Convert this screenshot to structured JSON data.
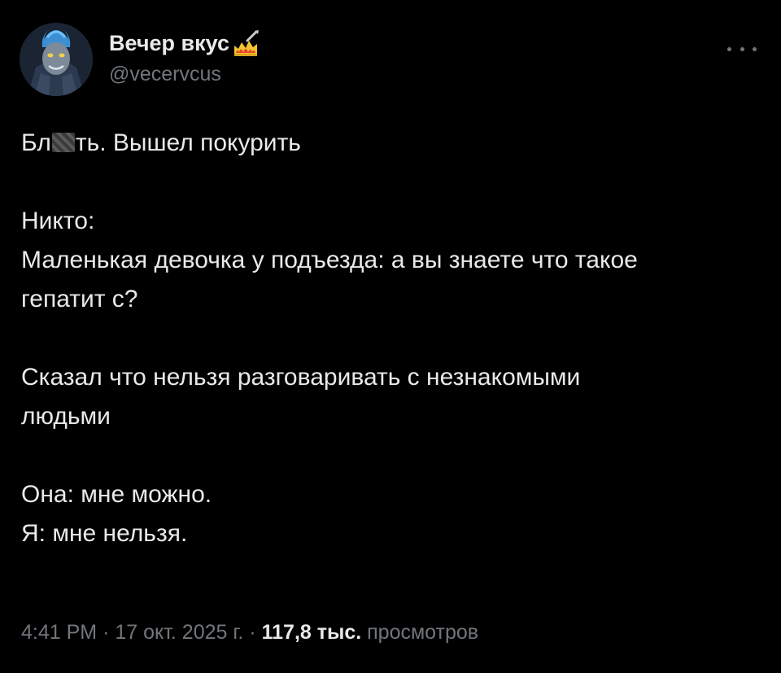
{
  "author": {
    "display_name": "Вечер вкус",
    "handle": "@vecervcus",
    "avatar_icon": "avatar-hades-icon",
    "badge_icon": "crown-flame-icon"
  },
  "post": {
    "line_1_prefix": "Бл",
    "line_1_suffix": "ть. Вышел покурить",
    "line_2": "Никто:",
    "line_3": "Маленькая девочка у подъезда: а вы знаете что такое",
    "line_4": "гепатит с?",
    "line_5": "Сказал что нельзя разговаривать с незнакомыми",
    "line_6": "людьми",
    "line_7": "Она: мне можно.",
    "line_8": "Я: мне нельзя."
  },
  "meta": {
    "time": "4:41 PM",
    "date": "17 окт. 2025 г.",
    "separator": "·",
    "views_count": "117,8 тыс.",
    "views_label": "просмотров"
  },
  "colors": {
    "background": "#000000",
    "text_primary": "#e7e9ea",
    "text_secondary": "#71767b"
  }
}
